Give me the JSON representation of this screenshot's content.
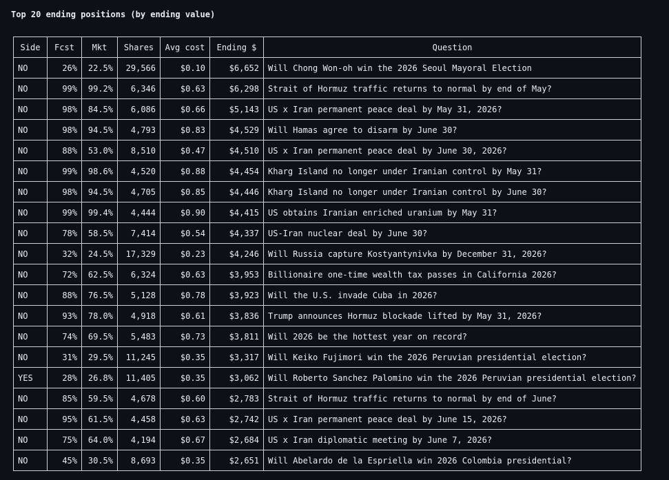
{
  "title": "Top 20 ending positions (by ending value)",
  "columns": [
    "Side",
    "Fcst",
    "Mkt",
    "Shares",
    "Avg cost",
    "Ending $",
    "Question"
  ],
  "rows": [
    [
      "NO",
      "26%",
      "22.5%",
      "29,566",
      "$0.10",
      "$6,652",
      "Will Chong Won-oh win the 2026 Seoul Mayoral Election"
    ],
    [
      "NO",
      "99%",
      "99.2%",
      "6,346",
      "$0.63",
      "$6,298",
      "Strait of Hormuz traffic returns to normal by end of May?"
    ],
    [
      "NO",
      "98%",
      "84.5%",
      "6,086",
      "$0.66",
      "$5,143",
      "US x Iran permanent peace deal by May 31, 2026?"
    ],
    [
      "NO",
      "98%",
      "94.5%",
      "4,793",
      "$0.83",
      "$4,529",
      "Will Hamas agree to disarm by June 30?"
    ],
    [
      "NO",
      "88%",
      "53.0%",
      "8,510",
      "$0.47",
      "$4,510",
      "US x Iran permanent peace deal by June 30, 2026?"
    ],
    [
      "NO",
      "99%",
      "98.6%",
      "4,520",
      "$0.88",
      "$4,454",
      "Kharg Island no longer under Iranian control by May 31?"
    ],
    [
      "NO",
      "98%",
      "94.5%",
      "4,705",
      "$0.85",
      "$4,446",
      "Kharg Island no longer under Iranian control by June 30?"
    ],
    [
      "NO",
      "99%",
      "99.4%",
      "4,444",
      "$0.90",
      "$4,415",
      "US obtains Iranian enriched uranium by May 31?"
    ],
    [
      "NO",
      "78%",
      "58.5%",
      "7,414",
      "$0.54",
      "$4,337",
      "US-Iran nuclear deal by June 30?"
    ],
    [
      "NO",
      "32%",
      "24.5%",
      "17,329",
      "$0.23",
      "$4,246",
      "Will Russia capture Kostyantynivka by December 31, 2026?"
    ],
    [
      "NO",
      "72%",
      "62.5%",
      "6,324",
      "$0.63",
      "$3,953",
      "Billionaire one-time wealth tax passes in California 2026?"
    ],
    [
      "NO",
      "88%",
      "76.5%",
      "5,128",
      "$0.78",
      "$3,923",
      "Will the U.S. invade Cuba in 2026?"
    ],
    [
      "NO",
      "93%",
      "78.0%",
      "4,918",
      "$0.61",
      "$3,836",
      "Trump announces Hormuz blockade lifted by May 31, 2026?"
    ],
    [
      "NO",
      "74%",
      "69.5%",
      "5,483",
      "$0.73",
      "$3,811",
      "Will 2026 be the hottest year on record?"
    ],
    [
      "NO",
      "31%",
      "29.5%",
      "11,245",
      "$0.35",
      "$3,317",
      "Will Keiko Fujimori win the 2026 Peruvian presidential election?"
    ],
    [
      "YES",
      "28%",
      "26.8%",
      "11,405",
      "$0.35",
      "$3,062",
      "Will Roberto Sanchez Palomino win the 2026 Peruvian presidential election?"
    ],
    [
      "NO",
      "85%",
      "59.5%",
      "4,678",
      "$0.60",
      "$2,783",
      "Strait of Hormuz traffic returns to normal by end of June?"
    ],
    [
      "NO",
      "95%",
      "61.5%",
      "4,458",
      "$0.63",
      "$2,742",
      "US x Iran permanent peace deal by June 15, 2026?"
    ],
    [
      "NO",
      "75%",
      "64.0%",
      "4,194",
      "$0.67",
      "$2,684",
      "US x Iran diplomatic meeting by June 7, 2026?"
    ],
    [
      "NO",
      "45%",
      "30.5%",
      "8,693",
      "$0.35",
      "$2,651",
      "Will Abelardo de la Espriella win 2026 Colombia presidential?"
    ]
  ]
}
